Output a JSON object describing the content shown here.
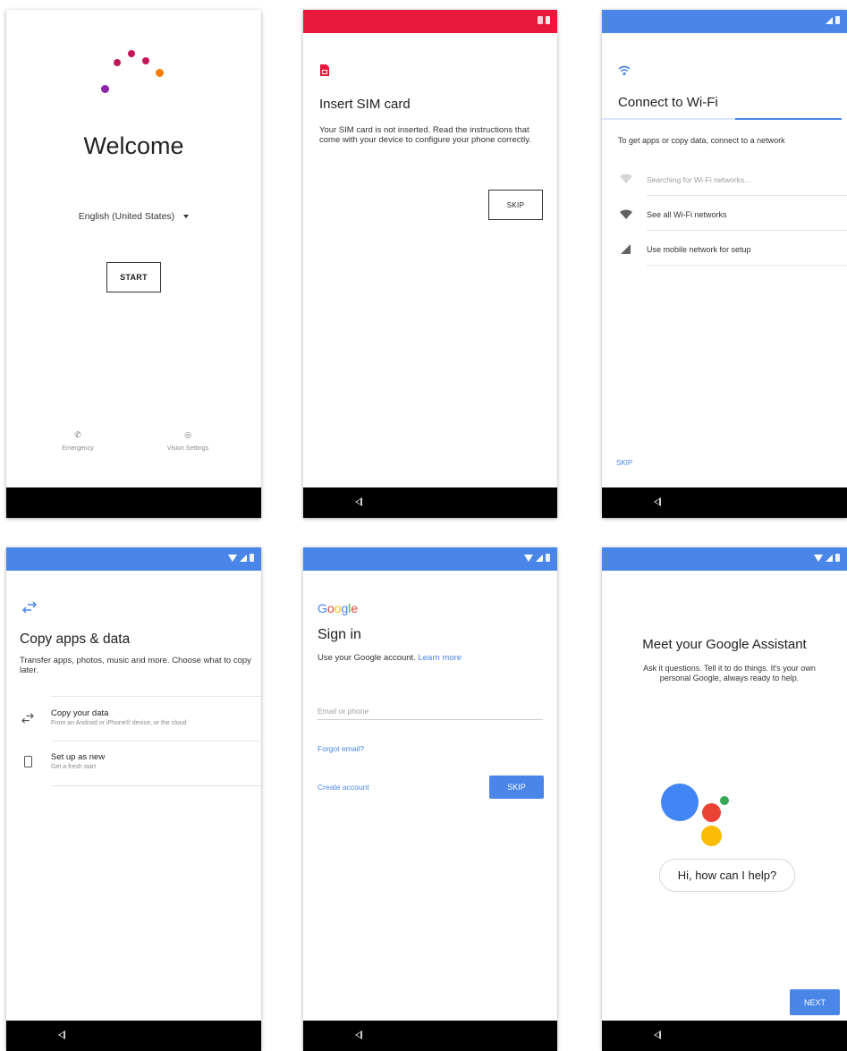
{
  "colors": {
    "status_red": "#e8193c",
    "status_blue": "#4a86e8",
    "accent_blue": "#4a86e8",
    "google_blue": "#4285f4",
    "google_red": "#ea4335",
    "google_yellow": "#fbbc05",
    "google_green": "#34a853",
    "logo_magenta": "#c2185b",
    "logo_purple": "#8e24aa",
    "logo_orange": "#f57c00"
  },
  "welcome_screen": {
    "title": "Welcome",
    "language": "English (United States)",
    "start_label": "START",
    "emergency_label": "Emergency",
    "vision_label": "Vision Settings",
    "icons": [
      "phone-icon",
      "eye-icon",
      "dropdown-caret-icon"
    ]
  },
  "sim_screen": {
    "title": "Insert SIM card",
    "body": "Your SIM card is not inserted. Read the instructions that come with your device to configure your phone correctly.",
    "skip_label": "SKIP",
    "icons": [
      "sim-card-icon"
    ]
  },
  "wifi_screen": {
    "title": "Connect to Wi-Fi",
    "subtitle": "To get apps or copy data, connect to a network",
    "progress": 0.66,
    "items": [
      {
        "label": "Searching for Wi-Fi networks...",
        "icon": "wifi-searching-icon"
      },
      {
        "label": "See all Wi-Fi networks",
        "icon": "wifi-icon"
      },
      {
        "label": "Use mobile network for setup",
        "icon": "cell-signal-icon"
      }
    ],
    "skip_label": "SKIP"
  },
  "copy_screen": {
    "title": "Copy apps & data",
    "body": "Transfer apps, photos, music and more. Choose what to copy later.",
    "options": [
      {
        "title": "Copy your data",
        "subtitle": "From an Android or iPhone® device, or the cloud",
        "icon": "transfer-icon"
      },
      {
        "title": "Set up as new",
        "subtitle": "Get a fresh start",
        "icon": "phone-outline-icon"
      }
    ]
  },
  "signin_screen": {
    "logo": [
      "G",
      "o",
      "o",
      "g",
      "l",
      "e"
    ],
    "title": "Sign in",
    "subtitle": "Use your Google account.",
    "learn_more": "Learn more",
    "email_placeholder": "Email or phone",
    "forgot_email": "Forgot email?",
    "create_account": "Create account",
    "skip_label": "SKIP"
  },
  "assistant_screen": {
    "title": "Meet your Google Assistant",
    "body": "Ask it questions. Tell it to do things. It's your own personal Google, always ready to help.",
    "bubble": "Hi, how can I help?",
    "next_label": "NEXT"
  }
}
